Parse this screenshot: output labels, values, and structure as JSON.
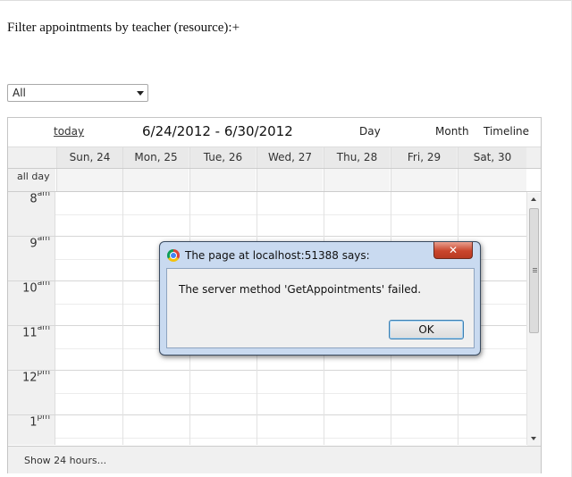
{
  "page": {
    "filter_label": "Filter appointments by teacher (resource):+",
    "resource_select": {
      "selected": "All"
    }
  },
  "calendar": {
    "header": {
      "today": "today",
      "range": "6/24/2012 - 6/30/2012",
      "views": {
        "day": "Day",
        "month": "Month",
        "timeline": "Timeline"
      }
    },
    "days": [
      "Sun, 24",
      "Mon, 25",
      "Tue, 26",
      "Wed, 27",
      "Thu, 28",
      "Fri, 29",
      "Sat, 30"
    ],
    "all_day_label": "all day",
    "hours": [
      {
        "hour": "8",
        "ampm": "am"
      },
      {
        "hour": "9",
        "ampm": "am"
      },
      {
        "hour": "10",
        "ampm": "am"
      },
      {
        "hour": "11",
        "ampm": "am"
      },
      {
        "hour": "12",
        "ampm": "pm"
      },
      {
        "hour": "1",
        "ampm": "pm"
      }
    ],
    "footer": {
      "show_24": "Show 24 hours..."
    }
  },
  "dialog": {
    "title": "The page at localhost:51388 says:",
    "close_glyph": "✕",
    "message": "The server method 'GetAppointments' failed.",
    "ok": "OK"
  }
}
